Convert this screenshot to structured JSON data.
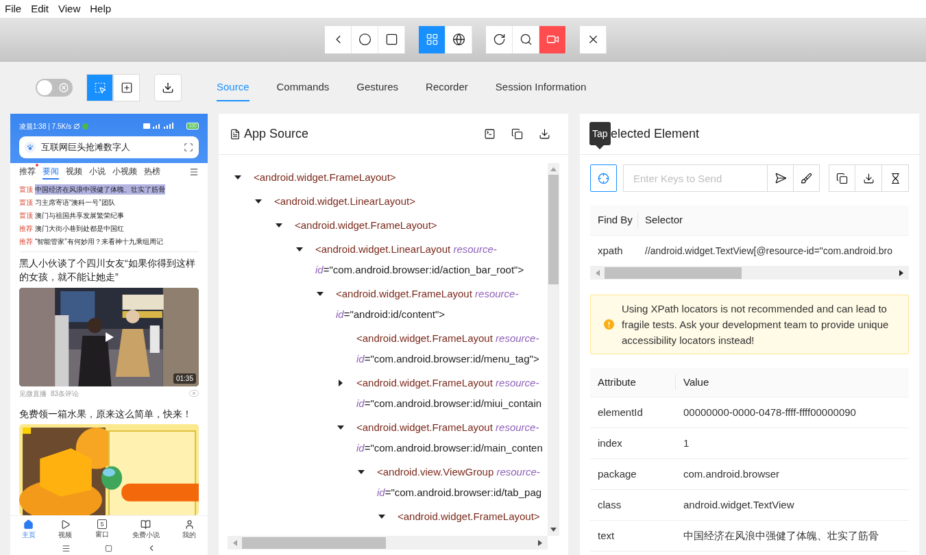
{
  "menu": [
    {
      "label": "File"
    },
    {
      "label": "Edit"
    },
    {
      "label": "View"
    },
    {
      "label": "Help"
    }
  ],
  "device_toolbar": {
    "groups": [
      [
        {
          "selected": false
        },
        {
          "selected": false
        },
        {
          "selected": false
        }
      ],
      [
        {
          "selected": true
        },
        {
          "selected": false
        }
      ],
      [
        {
          "selected": false
        },
        {
          "selected": false
        },
        {
          "selected": false
        }
      ],
      [
        {
          "selected": false
        }
      ]
    ]
  },
  "inspector_bar": {
    "switch_on": false,
    "mode_buttons": [
      {
        "selected": true
      },
      {
        "selected": false
      }
    ],
    "tabs": [
      {
        "label": "Source",
        "selected": true
      },
      {
        "label": "Commands",
        "selected": false
      },
      {
        "label": "Gestures",
        "selected": false
      },
      {
        "label": "Recorder",
        "selected": false
      },
      {
        "label": "Session Information",
        "selected": false
      }
    ]
  },
  "device_screen": {
    "status_text": "凌晨1:38 | 7.5K/s",
    "battery": "100",
    "search_text": "互联网巨头抢滩数字人",
    "channel_tabs": [
      {
        "label": "推荐",
        "selected": false,
        "dot": true
      },
      {
        "label": "要闻",
        "selected": true,
        "dot": false
      },
      {
        "label": "视频",
        "selected": false,
        "dot": false
      },
      {
        "label": "小说",
        "selected": false,
        "dot": false
      },
      {
        "label": "小视频",
        "selected": false,
        "dot": false
      },
      {
        "label": "热榜",
        "selected": false,
        "dot": false
      }
    ],
    "headlines": [
      {
        "tag": "置顶",
        "text": "中国经济在风浪中强健了体魄、壮实了筋骨",
        "selected": true
      },
      {
        "tag": "置顶",
        "text": "习主席寄语“澳科一号”团队",
        "selected": false
      },
      {
        "tag": "置顶",
        "text": "澳门与祖国共享发展繁荣纪事",
        "selected": false
      },
      {
        "tag": "推荐",
        "text": "澳门大街小巷到处都是中国红",
        "selected": false
      },
      {
        "tag": "推荐",
        "text": "“智能管家”有何妙用？来看神十九乘组周记",
        "selected": false
      }
    ],
    "article": {
      "title": "黑人小伙谈了个四川女友“如果你得到这样的女孩，就不能让她走”",
      "duration": "01:35",
      "source": "见微直播",
      "comments": "83条评论"
    },
    "ad": {
      "title": "免费领一箱水果，原来这么简单，快来！"
    },
    "bottom_nav": [
      {
        "label": "主页",
        "selected": true
      },
      {
        "label": "视频",
        "selected": false
      },
      {
        "label": "窗口",
        "selected": false,
        "badge": "5"
      },
      {
        "label": "免费小说",
        "selected": false
      },
      {
        "label": "我的",
        "selected": false
      }
    ]
  },
  "source_panel": {
    "title": "App Source",
    "tree": [
      {
        "kind": "branch",
        "expanded": true,
        "text": "<android.widget.FrameLayout>",
        "children": [
          {
            "kind": "branch",
            "expanded": true,
            "text": "<android.widget.LinearLayout>",
            "children": [
              {
                "kind": "branch",
                "expanded": true,
                "text": "<android.widget.FrameLayout>",
                "children": [
                  {
                    "kind": "branch",
                    "expanded": true,
                    "tag": "<android.widget.LinearLayout",
                    "attr": [
                      "resource-",
                      "id"
                    ],
                    "value": "=\"com.android.browser:id/action_bar_root\">",
                    "children": [
                      {
                        "kind": "branch",
                        "expanded": true,
                        "tag": "<android.widget.FrameLayout",
                        "attr": [
                          "resource-",
                          "id"
                        ],
                        "value": "=\"android:id/content\">",
                        "children": [
                          {
                            "kind": "leaf",
                            "tag": "<android.widget.FrameLayout",
                            "attr": [
                              "resource-",
                              "id"
                            ],
                            "value": "=\"com.android.browser:id/menu_tag\">"
                          },
                          {
                            "kind": "branch",
                            "expanded": false,
                            "tag": "<android.widget.FrameLayout",
                            "attr": [
                              "resource-",
                              "id"
                            ],
                            "value": "=\"com.android.browser:id/miui_contain"
                          },
                          {
                            "kind": "branch",
                            "expanded": true,
                            "tag": "<android.widget.FrameLayout",
                            "attr": [
                              "resource-",
                              "id"
                            ],
                            "value": "=\"com.android.browser:id/main_conten",
                            "children": [
                              {
                                "kind": "branch",
                                "expanded": true,
                                "tag": "<android.view.ViewGroup",
                                "attr": [
                                  "resource-",
                                  "id"
                                ],
                                "value": "=\"com.android.browser:id/tab_pag",
                                "children": [
                                  {
                                    "kind": "branch",
                                    "expanded": true,
                                    "text": "<android.widget.FrameLayout>"
                                  }
                                ]
                              }
                            ]
                          }
                        ]
                      }
                    ]
                  }
                ]
              }
            ]
          }
        ]
      }
    ]
  },
  "selected_element": {
    "title": "elected Element",
    "tooltip": "Tap",
    "locate_selected": true,
    "keys_placeholder": "Enter Keys to Send",
    "selector_table": {
      "columns": [
        "Find By",
        "Selector"
      ],
      "rows": [
        [
          "xpath",
          "//android.widget.TextView[@resource-id=\"com.android.bro"
        ]
      ]
    },
    "warning": "Using XPath locators is not recommended and can lead to fragile tests. Ask your development team to provide unique accessibility locators instead!",
    "attribute_table": {
      "columns": [
        "Attribute",
        "Value"
      ],
      "rows": [
        [
          "elementId",
          "00000000-0000-0478-ffff-ffff00000090"
        ],
        [
          "index",
          "1"
        ],
        [
          "package",
          "com.android.browser"
        ],
        [
          "class",
          "android.widget.TextView"
        ],
        [
          "text",
          "中国经济在风浪中强健了体魄、壮实了筋骨"
        ]
      ]
    }
  }
}
